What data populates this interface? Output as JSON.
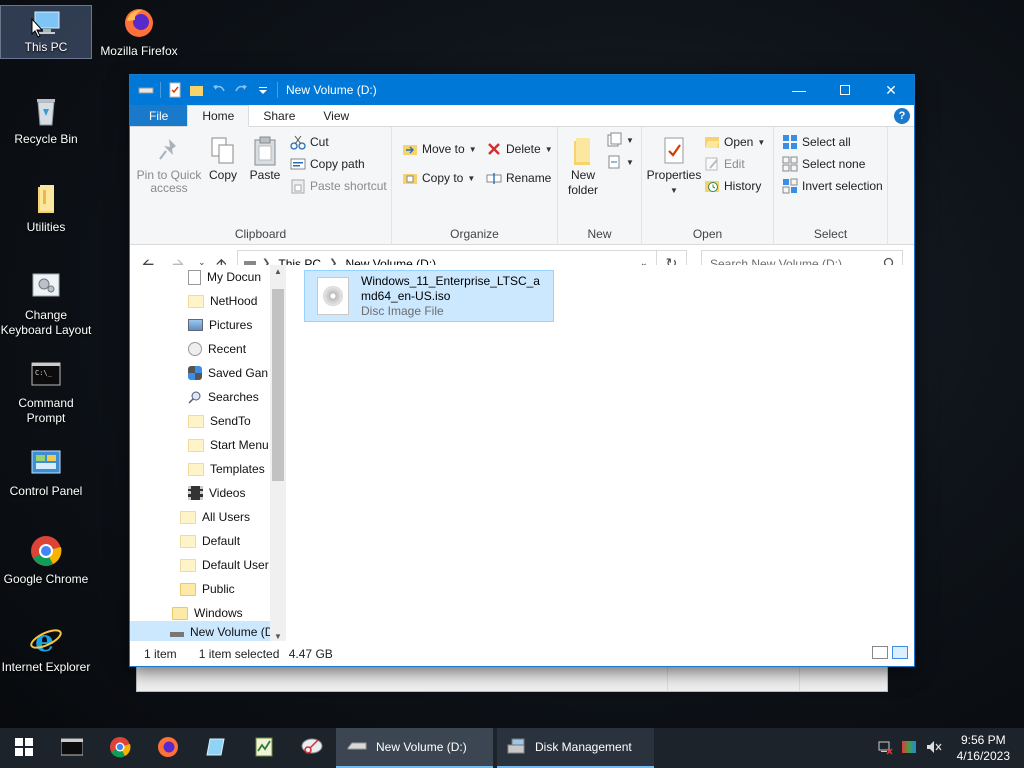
{
  "desktop": {
    "icons": [
      {
        "label": "This PC",
        "icon": "this-pc-icon"
      },
      {
        "label": "Mozilla Firefox",
        "icon": "firefox-icon"
      },
      {
        "label": "Recycle Bin",
        "icon": "recycle-bin-icon"
      },
      {
        "label": "Utilities",
        "icon": "folder-icon"
      },
      {
        "label": "Change Keyboard Layout",
        "icon": "keyboard-settings-icon"
      },
      {
        "label": "Command Prompt",
        "icon": "command-prompt-icon"
      },
      {
        "label": "Control Panel",
        "icon": "control-panel-icon"
      },
      {
        "label": "Google Chrome",
        "icon": "chrome-icon"
      },
      {
        "label": "Internet Explorer",
        "icon": "internet-explorer-icon"
      }
    ]
  },
  "window": {
    "title": "New Volume (D:)",
    "tabs": {
      "file": "File",
      "home": "Home",
      "share": "Share",
      "view": "View"
    },
    "help": "?"
  },
  "ribbon": {
    "clipboard": {
      "label": "Clipboard",
      "pin": "Pin to Quick access",
      "pin_line1": "Pin to Quick",
      "pin_line2": "access",
      "copy": "Copy",
      "paste": "Paste",
      "cut": "Cut",
      "copy_path": "Copy path",
      "paste_shortcut": "Paste shortcut"
    },
    "organize": {
      "label": "Organize",
      "move_to": "Move to",
      "copy_to": "Copy to",
      "delete": "Delete",
      "rename": "Rename"
    },
    "new": {
      "label": "New",
      "new_folder_line1": "New",
      "new_folder_line2": "folder"
    },
    "open": {
      "label": "Open",
      "properties": "Properties",
      "open": "Open",
      "edit": "Edit",
      "history": "History"
    },
    "select": {
      "label": "Select",
      "select_all": "Select all",
      "select_none": "Select none",
      "invert": "Invert selection"
    }
  },
  "address": {
    "crumbs": [
      "This PC",
      "New Volume (D:)"
    ],
    "search_placeholder": "Search New Volume (D:)"
  },
  "navpane": {
    "items": [
      {
        "label": "My Docun",
        "icon": "documents-icon"
      },
      {
        "label": "NetHood",
        "icon": "folder-icon"
      },
      {
        "label": "Pictures",
        "icon": "pictures-icon"
      },
      {
        "label": "Recent",
        "icon": "recent-icon"
      },
      {
        "label": "Saved Gan",
        "icon": "saved-games-icon"
      },
      {
        "label": "Searches",
        "icon": "search-icon"
      },
      {
        "label": "SendTo",
        "icon": "folder-icon"
      },
      {
        "label": "Start Menu",
        "icon": "folder-icon"
      },
      {
        "label": "Templates",
        "icon": "folder-icon"
      },
      {
        "label": "Videos",
        "icon": "videos-icon"
      },
      {
        "label": "All Users",
        "icon": "folder-icon"
      },
      {
        "label": "Default",
        "icon": "folder-icon"
      },
      {
        "label": "Default User",
        "icon": "folder-icon"
      },
      {
        "label": "Public",
        "icon": "folder-icon"
      },
      {
        "label": "Windows",
        "icon": "folder-icon"
      },
      {
        "label": "New Volume (D",
        "icon": "drive-icon"
      }
    ]
  },
  "content": {
    "files": [
      {
        "name": "Windows_11_Enterprise_LTSC_amd64_en-US.iso",
        "type": "Disc Image File",
        "icon": "disc-image-icon"
      }
    ]
  },
  "status": {
    "count": "1 item",
    "selection": "1 item selected",
    "size": "4.47 GB"
  },
  "taskbar": {
    "tasks": [
      {
        "label": "New Volume (D:)",
        "icon": "drive-icon"
      },
      {
        "label": "Disk Management",
        "icon": "disk-management-icon"
      }
    ],
    "clock": {
      "time": "9:56 PM",
      "date": "4/16/2023"
    }
  },
  "colors": {
    "accent": "#0078d7",
    "selection": "#cce8ff",
    "taskbar": "#1c232b"
  }
}
